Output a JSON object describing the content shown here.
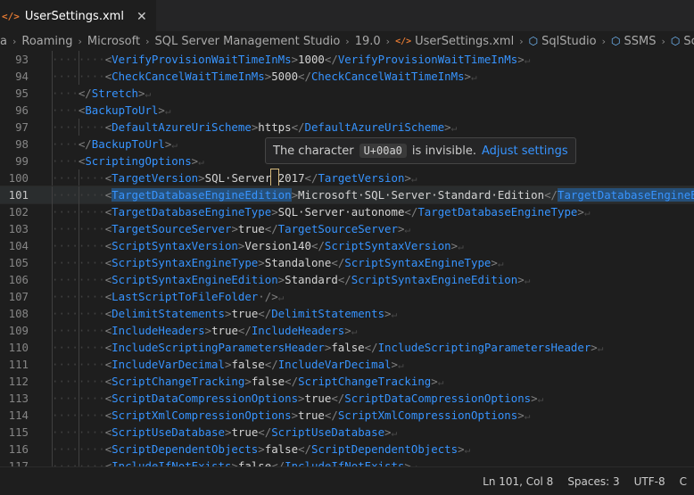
{
  "tab": {
    "icon": "</>",
    "label": "UserSettings.xml",
    "close": "✕"
  },
  "breadcrumb": [
    {
      "label": "a",
      "icon": ""
    },
    {
      "label": "Roaming",
      "icon": ""
    },
    {
      "label": "Microsoft",
      "icon": ""
    },
    {
      "label": "SQL Server Management Studio",
      "icon": ""
    },
    {
      "label": "19.0",
      "icon": ""
    },
    {
      "label": "UserSettings.xml",
      "icon": "</>"
    },
    {
      "label": "SqlStudio",
      "icon": "node"
    },
    {
      "label": "SSMS",
      "icon": "node"
    },
    {
      "label": "ScriptingOptio",
      "icon": "node"
    }
  ],
  "tooltip": {
    "prefix": "The character",
    "code": "U+00a0",
    "suffix": "is invisible.",
    "link": "Adjust settings"
  },
  "lines": [
    {
      "n": "93",
      "indent": 3,
      "kind": "pair",
      "open": "VerifyProvisionWaitTimeInMs",
      "text": "1000",
      "close": "VerifyProvisionWaitTimeInMs"
    },
    {
      "n": "94",
      "indent": 3,
      "kind": "pair",
      "open": "CheckCancelWaitTimeInMs",
      "text": "5000",
      "close": "CheckCancelWaitTimeInMs"
    },
    {
      "n": "95",
      "indent": 2,
      "kind": "close",
      "close": "Stretch"
    },
    {
      "n": "96",
      "indent": 2,
      "kind": "open",
      "open": "BackupToUrl"
    },
    {
      "n": "97",
      "indent": 3,
      "kind": "pair",
      "open": "DefaultAzureUriScheme",
      "text": "https",
      "close": "DefaultAzureUriScheme"
    },
    {
      "n": "98",
      "indent": 2,
      "kind": "close",
      "close": "BackupToUrl"
    },
    {
      "n": "99",
      "indent": 2,
      "kind": "open",
      "open": "ScriptingOptions"
    },
    {
      "n": "100",
      "indent": 3,
      "kind": "pair",
      "open": "TargetVersion",
      "text": "SQL·Server",
      "nbsp": true,
      "text2": "2017",
      "close": "TargetVersion"
    },
    {
      "n": "101",
      "indent": 3,
      "kind": "pair",
      "current": true,
      "hl": true,
      "open": "TargetDatabaseEngineEdition",
      "text": "Microsoft·SQL·Server·Standard·Edition",
      "close": "TargetDatabaseEngineEdition"
    },
    {
      "n": "102",
      "indent": 3,
      "kind": "pair",
      "open": "TargetDatabaseEngineType",
      "text": "SQL·Server·autonome",
      "close": "TargetDatabaseEngineType"
    },
    {
      "n": "103",
      "indent": 3,
      "kind": "pair",
      "open": "TargetSourceServer",
      "text": "true",
      "close": "TargetSourceServer"
    },
    {
      "n": "104",
      "indent": 3,
      "kind": "pair",
      "open": "ScriptSyntaxVersion",
      "text": "Version140",
      "close": "ScriptSyntaxVersion"
    },
    {
      "n": "105",
      "indent": 3,
      "kind": "pair",
      "open": "ScriptSyntaxEngineType",
      "text": "Standalone",
      "close": "ScriptSyntaxEngineType"
    },
    {
      "n": "106",
      "indent": 3,
      "kind": "pair",
      "open": "ScriptSyntaxEngineEdition",
      "text": "Standard",
      "close": "ScriptSyntaxEngineEdition"
    },
    {
      "n": "107",
      "indent": 3,
      "kind": "self",
      "open": "LastScriptToFileFolder"
    },
    {
      "n": "108",
      "indent": 3,
      "kind": "pair",
      "open": "DelimitStatements",
      "text": "true",
      "close": "DelimitStatements"
    },
    {
      "n": "109",
      "indent": 3,
      "kind": "pair",
      "open": "IncludeHeaders",
      "text": "true",
      "close": "IncludeHeaders"
    },
    {
      "n": "110",
      "indent": 3,
      "kind": "pair",
      "open": "IncludeScriptingParametersHeader",
      "text": "false",
      "close": "IncludeScriptingParametersHeader"
    },
    {
      "n": "111",
      "indent": 3,
      "kind": "pair",
      "open": "IncludeVarDecimal",
      "text": "false",
      "close": "IncludeVarDecimal"
    },
    {
      "n": "112",
      "indent": 3,
      "kind": "pair",
      "open": "ScriptChangeTracking",
      "text": "false",
      "close": "ScriptChangeTracking"
    },
    {
      "n": "113",
      "indent": 3,
      "kind": "pair",
      "open": "ScriptDataCompressionOptions",
      "text": "true",
      "close": "ScriptDataCompressionOptions"
    },
    {
      "n": "114",
      "indent": 3,
      "kind": "pair",
      "open": "ScriptXmlCompressionOptions",
      "text": "true",
      "close": "ScriptXmlCompressionOptions"
    },
    {
      "n": "115",
      "indent": 3,
      "kind": "pair",
      "open": "ScriptUseDatabase",
      "text": "true",
      "close": "ScriptUseDatabase"
    },
    {
      "n": "116",
      "indent": 3,
      "kind": "pair",
      "open": "ScriptDependentObjects",
      "text": "false",
      "close": "ScriptDependentObjects"
    },
    {
      "n": "117",
      "indent": 3,
      "kind": "pair",
      "current2": true,
      "open": "IncludeIfNotExists",
      "text": "false",
      "close": "IncludeIfNotExists"
    }
  ],
  "status": {
    "position": "Ln 101, Col 8",
    "spaces": "Spaces: 3",
    "encoding": "UTF-8",
    "eol": "C"
  }
}
